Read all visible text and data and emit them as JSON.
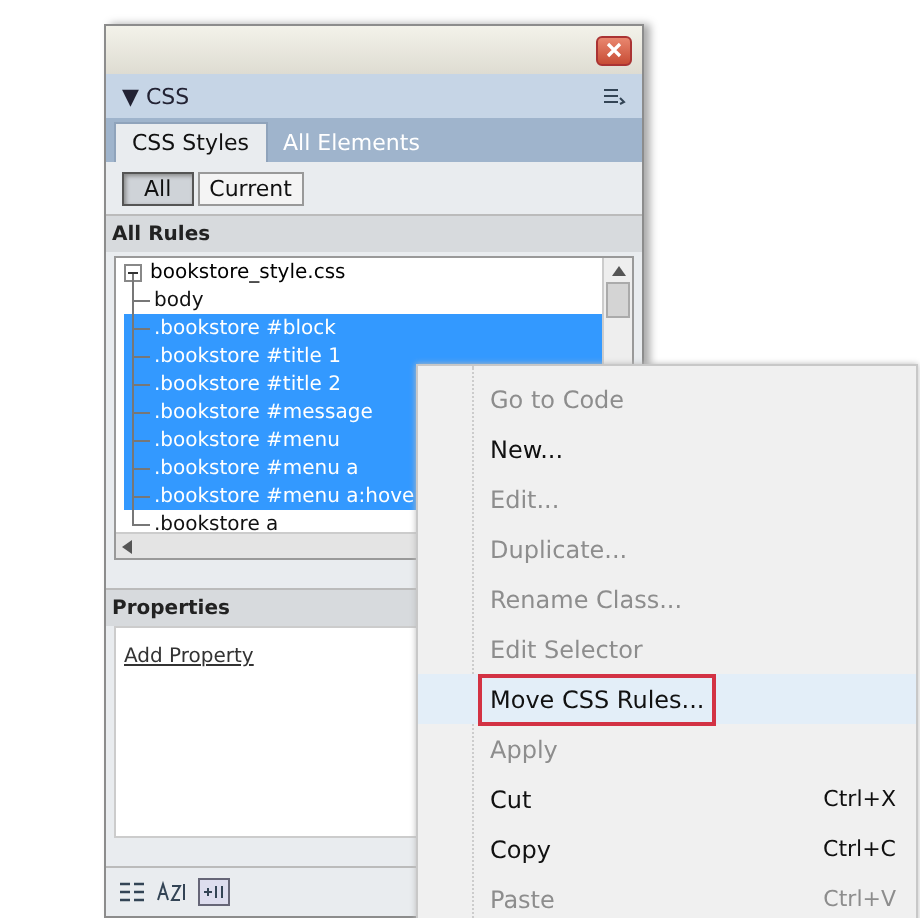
{
  "panel": {
    "header": "▼ CSS",
    "tabs": [
      {
        "label": "CSS Styles",
        "selected": true
      },
      {
        "label": "All Elements",
        "selected": false
      }
    ],
    "mode_buttons": [
      {
        "label": "All",
        "selected": true
      },
      {
        "label": "Current",
        "selected": false
      }
    ],
    "rules_heading": "All Rules",
    "rules": {
      "label": "bookstore_style.css",
      "expanded": true,
      "children": [
        {
          "label": "body",
          "selected": false
        },
        {
          "label": ".bookstore #block",
          "selected": true
        },
        {
          "label": ".bookstore #title 1",
          "selected": true
        },
        {
          "label": ".bookstore #title 2",
          "selected": true
        },
        {
          "label": ".bookstore #message",
          "selected": true
        },
        {
          "label": ".bookstore #menu",
          "selected": true
        },
        {
          "label": ".bookstore #menu a",
          "selected": true
        },
        {
          "label": ".bookstore #menu a:hove",
          "selected": true
        },
        {
          "label": ".bookstore a",
          "selected": false
        }
      ]
    },
    "properties_heading": "Properties",
    "add_property": "Add Property"
  },
  "context_menu": [
    {
      "label": "Go to Code",
      "disabled": true,
      "selected": false,
      "outlined": false
    },
    {
      "label": "New...",
      "disabled": false,
      "selected": false,
      "outlined": false
    },
    {
      "label": "Edit...",
      "disabled": true,
      "selected": false,
      "outlined": false
    },
    {
      "label": "Duplicate...",
      "disabled": true,
      "selected": false,
      "outlined": false
    },
    {
      "label": "Rename Class...",
      "disabled": true,
      "selected": false,
      "outlined": false
    },
    {
      "label": "Edit Selector",
      "disabled": true,
      "selected": false,
      "outlined": false
    },
    {
      "label": "Move CSS Rules...",
      "disabled": false,
      "selected": true,
      "outlined": true
    },
    {
      "label": "Apply",
      "disabled": true,
      "selected": false,
      "outlined": false
    },
    {
      "label": "Cut",
      "shortcut": "Ctrl+X",
      "disabled": false,
      "selected": false,
      "outlined": false
    },
    {
      "label": "Copy",
      "shortcut": "Ctrl+C",
      "disabled": false,
      "selected": false,
      "outlined": false
    },
    {
      "label": "Paste",
      "shortcut": "Ctrl+V",
      "disabled": true,
      "selected": false,
      "outlined": false
    }
  ]
}
